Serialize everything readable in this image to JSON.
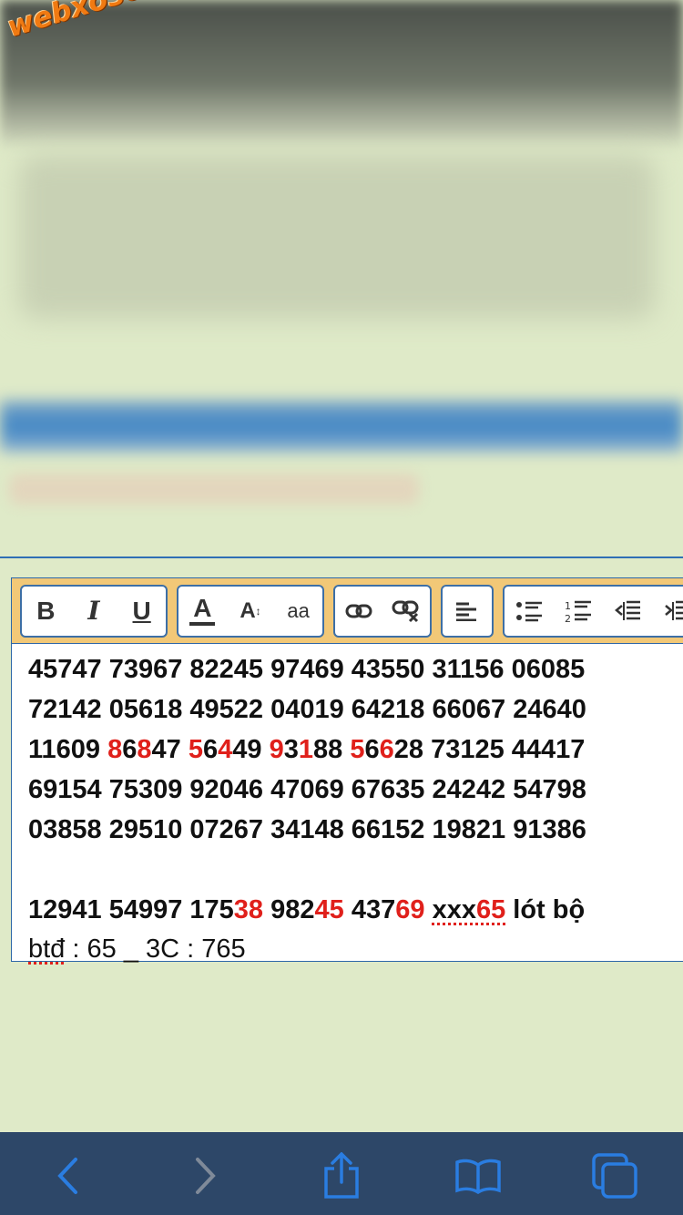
{
  "watermark": "webxoso.net",
  "toolbar": {
    "bold": "B",
    "italic": "I",
    "underline": "U",
    "font_color": "A",
    "font_size": "A",
    "font_case": "aa"
  },
  "content": {
    "rows": [
      [
        {
          "t": "45747 73967 82245 97469 43550 31156 06085"
        }
      ],
      [
        {
          "t": "72142 05618 49522 04019 64218 66067 24640"
        }
      ],
      [
        {
          "t": "11609 "
        },
        {
          "t": "8",
          "red": true
        },
        {
          "t": "6"
        },
        {
          "t": "8",
          "red": true
        },
        {
          "t": "47 "
        },
        {
          "t": "5",
          "red": true
        },
        {
          "t": "6"
        },
        {
          "t": "4",
          "red": true
        },
        {
          "t": "49 "
        },
        {
          "t": "9",
          "red": true
        },
        {
          "t": "3"
        },
        {
          "t": "1",
          "red": true
        },
        {
          "t": "88 "
        },
        {
          "t": "5",
          "red": true
        },
        {
          "t": "6"
        },
        {
          "t": "6",
          "red": true
        },
        {
          "t": "28 73125 44417"
        }
      ],
      [
        {
          "t": "69154 75309 92046 47069 67635 24242 54798"
        }
      ],
      [
        {
          "t": "03858 29510 07267 34148 66152 19821 91386"
        }
      ]
    ],
    "line2": [
      {
        "t": "12941 54997 175"
      },
      {
        "t": "38",
        "red": true
      },
      {
        "t": " 982"
      },
      {
        "t": "45",
        "red": true
      },
      {
        "t": " 437"
      },
      {
        "t": "69",
        "red": true
      },
      {
        "t": " "
      },
      {
        "t": "xxx",
        "squig": true
      },
      {
        "t": "65",
        "red": true,
        "squig": true
      },
      {
        "t": " lót bộ"
      }
    ],
    "line3": [
      {
        "t": "btđ",
        "squig": true,
        "plain": true
      },
      {
        "t": " : 65 _ 3C : 765",
        "plain": true
      }
    ]
  },
  "colors": {
    "accent_red": "#e0201b",
    "toolbar_bg": "#f2c877",
    "page_bg": "#dfeac8",
    "safari_bar": "#2d4768",
    "icon_blue": "#2a7de1"
  },
  "browser_bar": {
    "icons": [
      "back-icon",
      "forward-icon",
      "share-icon",
      "bookmarks-icon",
      "tabs-icon"
    ]
  }
}
